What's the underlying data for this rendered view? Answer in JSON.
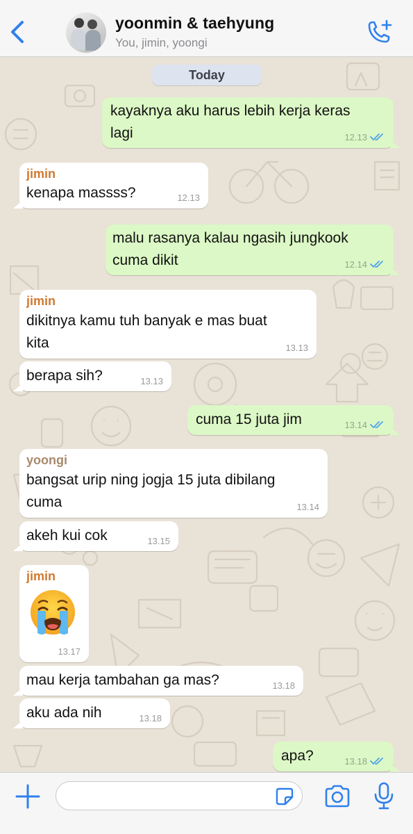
{
  "header": {
    "title": "yoonmin & taehyung",
    "subtitle": "You, jimin, yoongi"
  },
  "chat": {
    "date_label": "Today",
    "messages": [
      {
        "direction": "out",
        "text1": "kayaknya aku harus lebih kerja keras",
        "text2": "lagi",
        "time": "12.13"
      },
      {
        "direction": "in",
        "sender": "jimin",
        "text1": "kenapa massss?",
        "time": "12.13"
      },
      {
        "direction": "out",
        "text1": "malu rasanya kalau ngasih jungkook",
        "text2": "cuma dikit",
        "time": "12.14"
      },
      {
        "direction": "in",
        "sender": "jimin",
        "text1": "dikitnya kamu tuh banyak e mas buat",
        "text2": "kita",
        "time": "13.13"
      },
      {
        "direction": "in",
        "text1": "berapa sih?",
        "time": "13.13"
      },
      {
        "direction": "out",
        "text1": "cuma 15 juta jim",
        "time": "13.14"
      },
      {
        "direction": "in",
        "sender": "yoongi",
        "text1": "bangsat urip ning jogja 15 juta dibilang",
        "text2": "cuma",
        "time": "13.14"
      },
      {
        "direction": "in",
        "text1": "akeh kui cok",
        "time": "13.15"
      },
      {
        "direction": "in",
        "sender": "jimin",
        "emoji": "loudly-crying-face",
        "time": "13.17"
      },
      {
        "direction": "in",
        "text1": "mau kerja tambahan ga mas?",
        "time": "13.18"
      },
      {
        "direction": "in",
        "text1": "aku ada nih",
        "time": "13.18"
      },
      {
        "direction": "out",
        "text1": "apa?",
        "time": "13.18"
      }
    ]
  },
  "composer": {
    "value": "",
    "placeholder": ""
  },
  "colors": {
    "accent": "#2f80ed",
    "jimin": "#d0792f",
    "yoongi": "#a88a6b",
    "outgoing_bubble": "#dcf8c6",
    "incoming_bubble": "#ffffff",
    "read_ticks": "#4fa3e8"
  }
}
